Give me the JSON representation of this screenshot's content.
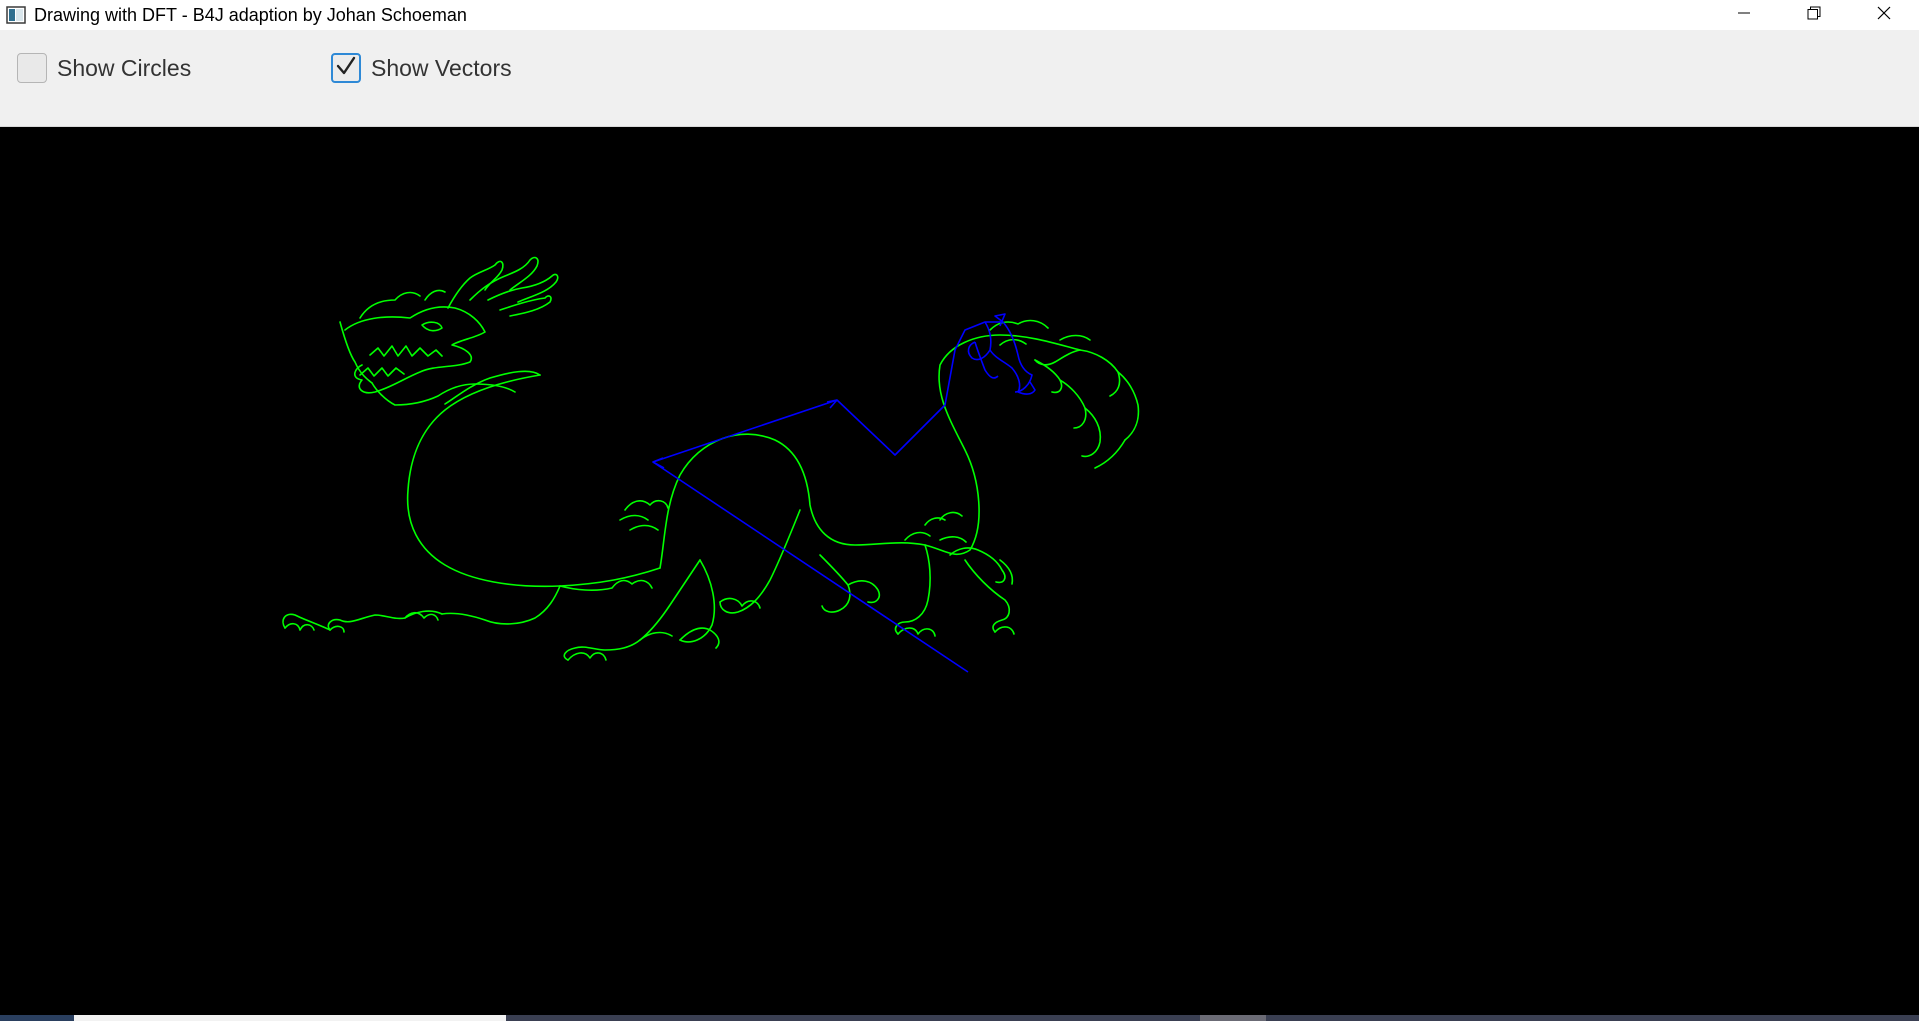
{
  "window": {
    "title": "Drawing with DFT - B4J adaption by Johan Schoeman",
    "controls": [
      "minimize-icon",
      "restore-icon",
      "close-icon"
    ]
  },
  "toolbar": {
    "checkboxes": [
      {
        "label": "Show Circles",
        "checked": false
      },
      {
        "label": "Show Vectors",
        "checked": true
      }
    ]
  },
  "canvas": {
    "background": "#000000",
    "drawing_color": "#00ff00",
    "vector_color": "#0000ff",
    "drawing_subject": "dragon"
  },
  "colors": {
    "accent": "#2e89d6",
    "toolbar_bg": "#f0f0f0"
  }
}
